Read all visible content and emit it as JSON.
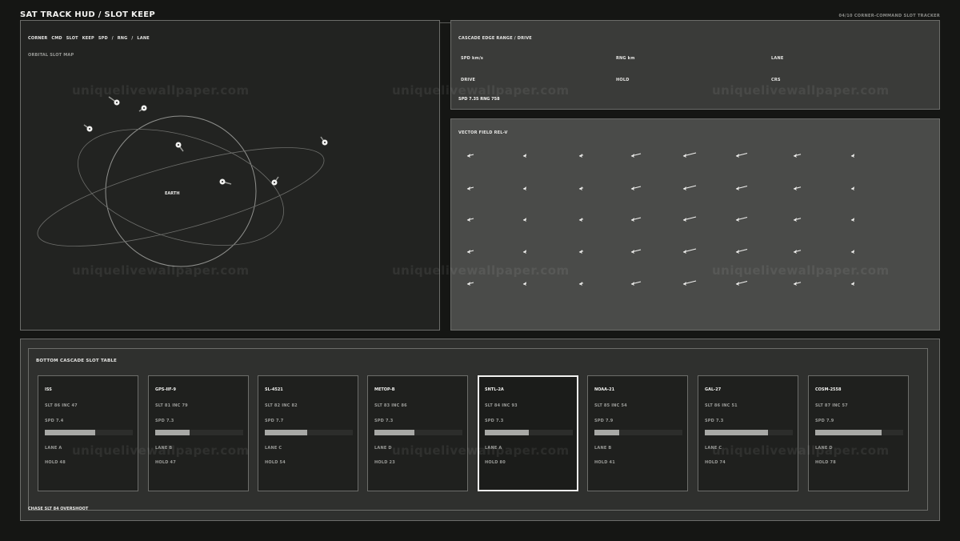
{
  "header": {
    "title": "SAT TRACK HUD  /  SLOT KEEP",
    "right_label": "04/10  CORNER-COMMAND SLOT TRACKER"
  },
  "map_panel": {
    "heading": "CORNER CMD  SLOT KEEP  SPD / RNG / LANE",
    "subheading": "ORBITAL SLOT MAP",
    "earth_label": "EARTH"
  },
  "cascade_panel": {
    "title": "CASCADE EDGE  RANGE / DRIVE",
    "fields": [
      "SPD km/s",
      "RNG km",
      "LANE",
      "DRIVE",
      "HOLD",
      "CRS"
    ],
    "summary": "SPD 7.35  RNG 758"
  },
  "vector_panel": {
    "title": "VECTOR FIELD  REL-V"
  },
  "bottom_panel": {
    "title": "BOTTOM CASCADE  SLOT TABLE",
    "footer": "CHASE SLT 84  OVERSHOOT",
    "cards": [
      {
        "name": "ISS",
        "slt": "SLT 86  INC 47",
        "spd": "SPD 7.4",
        "progress": 0.57,
        "lane": "LANE A",
        "hold": "HOLD 48"
      },
      {
        "name": "GPS-IIF-9",
        "slt": "SLT 81  INC 79",
        "spd": "SPD 7.3",
        "progress": 0.39,
        "lane": "LANE B",
        "hold": "HOLD 47"
      },
      {
        "name": "SL-4521",
        "slt": "SLT 82  INC 82",
        "spd": "SPD 7.7",
        "progress": 0.48,
        "lane": "LANE C",
        "hold": "HOLD 54"
      },
      {
        "name": "METOP-B",
        "slt": "SLT 83  INC 86",
        "spd": "SPD 7.3",
        "progress": 0.45,
        "lane": "LANE D",
        "hold": "HOLD 23"
      },
      {
        "name": "SNTL-2A",
        "slt": "SLT 84  INC 93",
        "spd": "SPD 7.3",
        "progress": 0.5,
        "lane": "LANE A",
        "hold": "HOLD 80",
        "active": true
      },
      {
        "name": "NOAA-21",
        "slt": "SLT 85  INC 54",
        "spd": "SPD 7.9",
        "progress": 0.28,
        "lane": "LANE B",
        "hold": "HOLD 41"
      },
      {
        "name": "GAL-27",
        "slt": "SLT 86  INC 51",
        "spd": "SPD 7.3",
        "progress": 0.72,
        "lane": "LANE C",
        "hold": "HOLD 74"
      },
      {
        "name": "COSM-2558",
        "slt": "SLT 87  INC 57",
        "spd": "SPD 7.9",
        "progress": 0.75,
        "lane": "LANE D",
        "hold": "HOLD 78"
      }
    ]
  },
  "watermark": "uniquelivewallpaper.com",
  "colors": {
    "background": "#151614",
    "map_panel": "#222321",
    "cascade_panel": "#3a3b39",
    "vector_panel": "#4a4b49",
    "bottom_panel": "#2f302e",
    "accent": "#f2f2f0"
  }
}
